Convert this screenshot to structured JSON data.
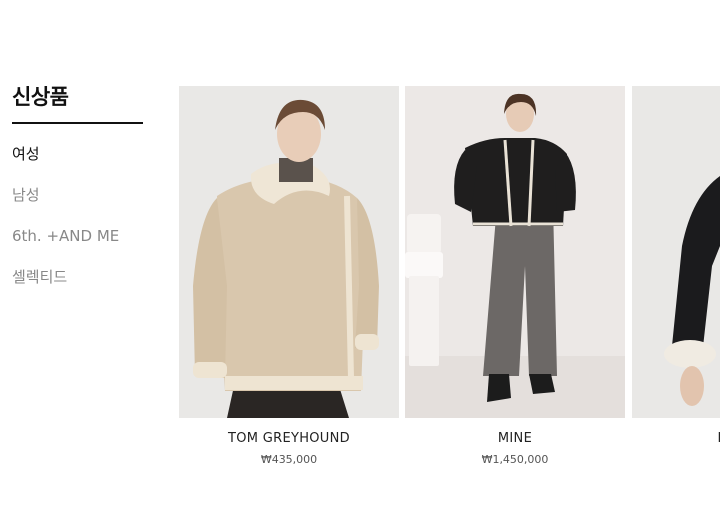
{
  "sidebar": {
    "title": "신상품",
    "items": [
      {
        "label": "여성",
        "active": true
      },
      {
        "label": "남성",
        "active": false
      },
      {
        "label": "6th. +AND ME",
        "active": false
      },
      {
        "label": "셀렉티드",
        "active": false
      }
    ]
  },
  "products": [
    {
      "name": "TOM GREYHOUND",
      "price": "₩435,000"
    },
    {
      "name": "MINE",
      "price": "₩1,450,000"
    },
    {
      "name": "FOURM",
      "price": "₩"
    }
  ]
}
